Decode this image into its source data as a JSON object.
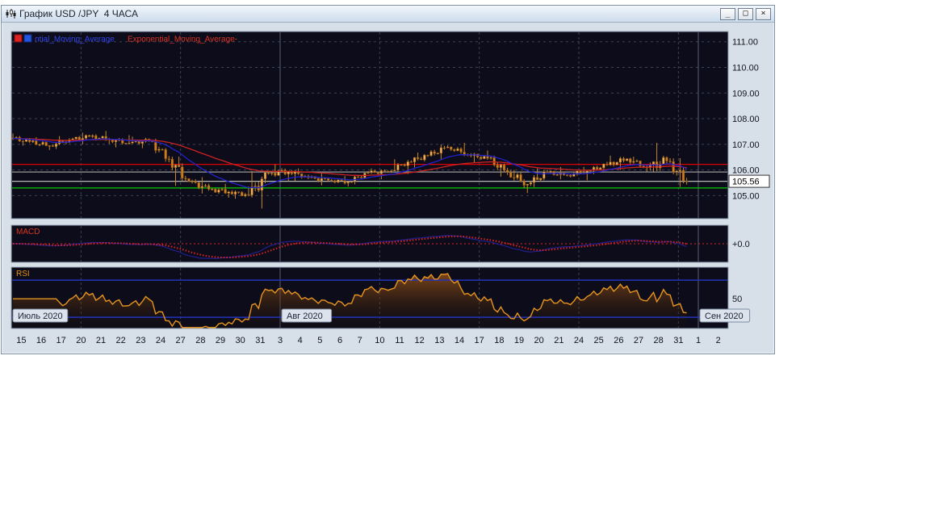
{
  "window": {
    "title": "График USD /JPY  4 ЧАСА",
    "minimize_glyph": "_",
    "restore_glyph": "□",
    "close_glyph": "×"
  },
  "chart": {
    "legend": {
      "ma1_label": "ntial_Moving_Average",
      "ma2_label": "Exponential_Moving_Average-",
      "swatch1_color": "#dd2222",
      "swatch2_color": "#2255dd"
    },
    "macd_label": "MACD",
    "rsi_label": "RSI",
    "macd_axis_label": "+0.0",
    "rsi_axis_label": "50",
    "current_price_label": "105.56",
    "y_tick_labels": [
      "111.00",
      "110.00",
      "109.00",
      "108.00",
      "107.00",
      "106.00",
      "105.00"
    ],
    "months": [
      {
        "label": "Июль 2020",
        "slot": -1
      },
      {
        "label": "Авг 2020",
        "slot": 13
      },
      {
        "label": "Сен 2020",
        "slot": 34
      }
    ],
    "colors": {
      "plot_bg": "#0c0c1a",
      "panel_border": "#9aa7ba",
      "grid": "#3f4358",
      "month_grid": "#5a5f78",
      "wick": "#c8872e",
      "candle_up": "#f2ae54",
      "candle_down": "#cf7d1e",
      "candle_edge": "#7a4e0e",
      "ma_fast": "#2222cc",
      "ma_slow": "#cc2222",
      "level_red": "#dd0000",
      "level_green": "#00cc00",
      "level_gray": "#9a9a9a",
      "current_line": "#b8b8b8",
      "macd_line": "#202090",
      "macd_signal": "#dd2222",
      "rsi_line": "#e6941e",
      "rsi_level": "#2233bb",
      "axis_text": "#10151c",
      "badge_bg": "#dde3ec",
      "badge_border": "#7d8ca1"
    }
  },
  "chart_data": {
    "type": "candlestick",
    "symbol": "USD/JPY",
    "timeframe_label": "4 ЧАСА",
    "y_range": [
      104.1,
      111.4
    ],
    "x_tick_labels": [
      "15",
      "16",
      "17",
      "20",
      "21",
      "22",
      "23",
      "24",
      "27",
      "28",
      "29",
      "30",
      "31",
      "3",
      "4",
      "5",
      "6",
      "7",
      "10",
      "11",
      "12",
      "13",
      "14",
      "17",
      "18",
      "19",
      "20",
      "21",
      "24",
      "25",
      "26",
      "27",
      "28",
      "31",
      "1",
      "2"
    ],
    "week_grid_slots": [
      3,
      8,
      13,
      18,
      23,
      28,
      33
    ],
    "month_boundary_slots": [
      13,
      34
    ],
    "daily_candles": [
      {
        "d": "15",
        "o": 107.25,
        "h": 107.42,
        "l": 106.95,
        "c": 107.1
      },
      {
        "d": "16",
        "o": 107.1,
        "h": 107.28,
        "l": 106.78,
        "c": 106.95
      },
      {
        "d": "17",
        "o": 106.95,
        "h": 107.32,
        "l": 106.82,
        "c": 107.18
      },
      {
        "d": "20",
        "o": 107.18,
        "h": 107.46,
        "l": 107.0,
        "c": 107.3
      },
      {
        "d": "21",
        "o": 107.3,
        "h": 107.52,
        "l": 107.02,
        "c": 107.2
      },
      {
        "d": "22",
        "o": 107.2,
        "h": 107.36,
        "l": 106.88,
        "c": 107.05
      },
      {
        "d": "23",
        "o": 107.05,
        "h": 107.3,
        "l": 106.85,
        "c": 107.15
      },
      {
        "d": "24",
        "o": 107.15,
        "h": 107.22,
        "l": 106.3,
        "c": 106.42
      },
      {
        "d": "27",
        "o": 106.42,
        "h": 106.52,
        "l": 105.38,
        "c": 105.55
      },
      {
        "d": "28",
        "o": 105.55,
        "h": 105.72,
        "l": 105.08,
        "c": 105.25
      },
      {
        "d": "29",
        "o": 105.25,
        "h": 105.46,
        "l": 104.92,
        "c": 105.15
      },
      {
        "d": "30",
        "o": 105.15,
        "h": 105.36,
        "l": 104.88,
        "c": 105.02
      },
      {
        "d": "31",
        "o": 105.02,
        "h": 105.96,
        "l": 104.5,
        "c": 105.86
      },
      {
        "d": "3",
        "o": 105.86,
        "h": 106.22,
        "l": 105.56,
        "c": 105.96
      },
      {
        "d": "4",
        "o": 105.96,
        "h": 106.06,
        "l": 105.58,
        "c": 105.7
      },
      {
        "d": "5",
        "o": 105.7,
        "h": 105.86,
        "l": 105.4,
        "c": 105.6
      },
      {
        "d": "6",
        "o": 105.6,
        "h": 105.76,
        "l": 105.36,
        "c": 105.54
      },
      {
        "d": "7",
        "o": 105.54,
        "h": 105.96,
        "l": 105.44,
        "c": 105.9
      },
      {
        "d": "10",
        "o": 105.9,
        "h": 106.06,
        "l": 105.64,
        "c": 105.94
      },
      {
        "d": "11",
        "o": 105.94,
        "h": 106.42,
        "l": 105.84,
        "c": 106.32
      },
      {
        "d": "12",
        "o": 106.32,
        "h": 106.68,
        "l": 106.1,
        "c": 106.56
      },
      {
        "d": "13",
        "o": 106.56,
        "h": 107.0,
        "l": 106.38,
        "c": 106.9
      },
      {
        "d": "14",
        "o": 106.9,
        "h": 107.06,
        "l": 106.54,
        "c": 106.6
      },
      {
        "d": "17",
        "o": 106.6,
        "h": 106.76,
        "l": 106.3,
        "c": 106.45
      },
      {
        "d": "18",
        "o": 106.45,
        "h": 106.56,
        "l": 105.74,
        "c": 105.9
      },
      {
        "d": "19",
        "o": 105.9,
        "h": 106.0,
        "l": 105.1,
        "c": 105.45
      },
      {
        "d": "20",
        "o": 105.45,
        "h": 106.06,
        "l": 105.34,
        "c": 105.9
      },
      {
        "d": "21",
        "o": 105.9,
        "h": 106.12,
        "l": 105.64,
        "c": 105.8
      },
      {
        "d": "24",
        "o": 105.8,
        "h": 106.12,
        "l": 105.6,
        "c": 105.96
      },
      {
        "d": "25",
        "o": 105.96,
        "h": 106.32,
        "l": 105.84,
        "c": 106.2
      },
      {
        "d": "26",
        "o": 106.2,
        "h": 106.56,
        "l": 106.0,
        "c": 106.44
      },
      {
        "d": "27",
        "o": 106.44,
        "h": 106.52,
        "l": 105.94,
        "c": 106.1
      },
      {
        "d": "28",
        "o": 106.1,
        "h": 107.06,
        "l": 105.94,
        "c": 106.35
      },
      {
        "d": "31",
        "o": 106.35,
        "h": 106.46,
        "l": 105.34,
        "c": 105.56
      }
    ],
    "levels": {
      "red_line": 106.22,
      "green_line": 105.3,
      "gray_line": 105.92,
      "current_price": 105.56
    },
    "indicators": {
      "ema_fast_period": 18,
      "ema_slow_period": 55,
      "macd_periods": [
        12,
        26,
        9
      ],
      "rsi_period": 14,
      "rsi_levels": [
        30,
        70
      ],
      "rsi_display_range": [
        18,
        84
      ]
    }
  }
}
